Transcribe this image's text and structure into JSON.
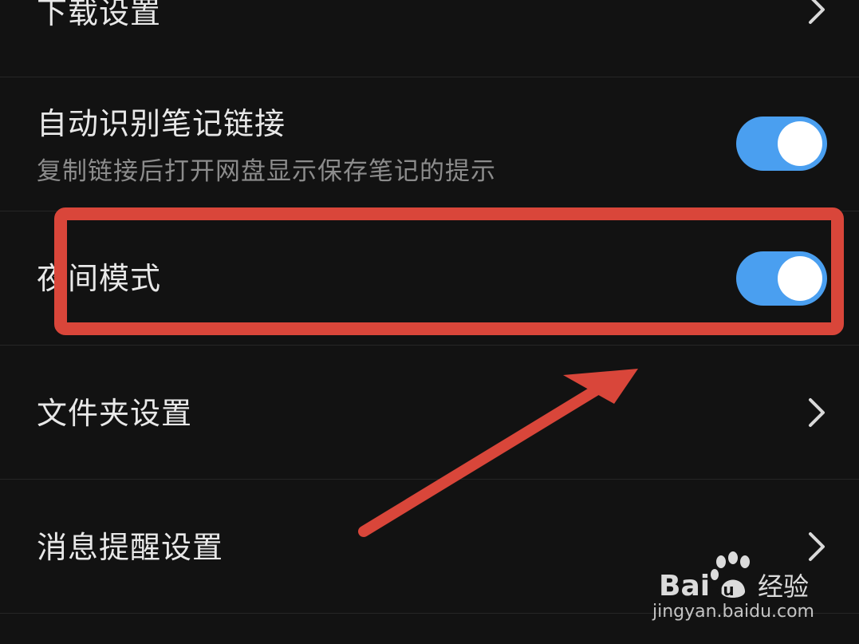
{
  "settings": {
    "rows": [
      {
        "title": "下载设置",
        "type": "link"
      },
      {
        "title": "自动识别笔记链接",
        "subtitle": "复制链接后打开网盘显示保存笔记的提示",
        "type": "toggle",
        "on": true
      },
      {
        "title": "夜间模式",
        "type": "toggle",
        "on": true
      },
      {
        "title": "文件夹设置",
        "type": "link"
      },
      {
        "title": "消息提醒设置",
        "type": "link"
      }
    ]
  },
  "colors": {
    "background": "#121212",
    "toggle_on": "#4a9ff0",
    "annotation": "#d9463a",
    "divider": "#262626"
  },
  "watermark": {
    "brand_mark": "Bai du 经验",
    "url": "jingyan.baidu.com"
  }
}
